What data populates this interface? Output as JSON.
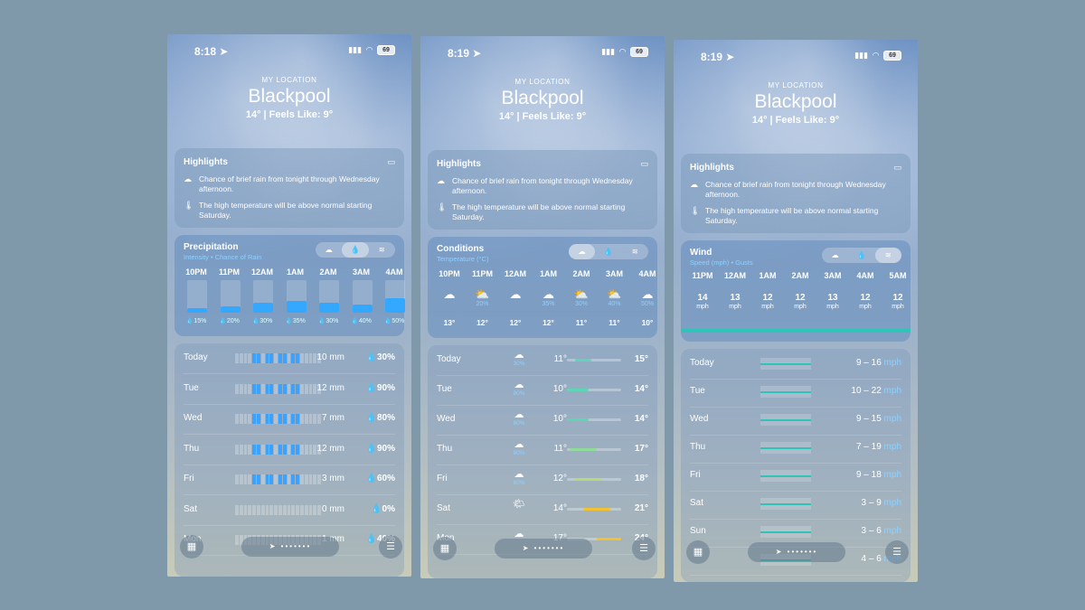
{
  "phones": [
    {
      "status": {
        "time": "8:18",
        "battery": "69"
      },
      "header": {
        "my_location": "MY LOCATION",
        "city": "Blackpool",
        "feels": "14°  |  Feels Like: 9°"
      },
      "highlights": {
        "title": "Highlights",
        "lines": [
          "Chance of brief rain from tonight through Wednesday afternoon.",
          "The high temperature will be above normal starting Saturday."
        ]
      },
      "module": {
        "title": "Precipitation",
        "subtitle": "Intensity • Chance of Rain",
        "hours": [
          {
            "label": "10PM",
            "chance": "15%",
            "level": 0.15
          },
          {
            "label": "11PM",
            "chance": "20%",
            "level": 0.2
          },
          {
            "label": "12AM",
            "chance": "30%",
            "level": 0.3
          },
          {
            "label": "1AM",
            "chance": "35%",
            "level": 0.35
          },
          {
            "label": "2AM",
            "chance": "30%",
            "level": 0.3
          },
          {
            "label": "3AM",
            "chance": "40%",
            "level": 0.25
          },
          {
            "label": "4AM",
            "chance": "50%",
            "level": 0.45
          }
        ]
      },
      "days": [
        {
          "name": "Today",
          "amount": "10 mm",
          "chance": "30%"
        },
        {
          "name": "Tue",
          "amount": "12 mm",
          "chance": "90%"
        },
        {
          "name": "Wed",
          "amount": "7 mm",
          "chance": "80%"
        },
        {
          "name": "Thu",
          "amount": "12 mm",
          "chance": "90%"
        },
        {
          "name": "Fri",
          "amount": "3 mm",
          "chance": "60%"
        },
        {
          "name": "Sat",
          "amount": "0 mm",
          "chance": "0%"
        },
        {
          "name": "Mon",
          "amount": "1 mm",
          "chance": "40%"
        }
      ]
    },
    {
      "status": {
        "time": "8:19",
        "battery": "69"
      },
      "header": {
        "my_location": "MY LOCATION",
        "city": "Blackpool",
        "feels": "14°  |  Feels Like: 9°"
      },
      "highlights": {
        "title": "Highlights",
        "lines": [
          "Chance of brief rain from tonight through Wednesday afternoon.",
          "The high temperature will be above normal starting Saturday."
        ]
      },
      "module": {
        "title": "Conditions",
        "subtitle": "Temperature (°C)",
        "hours": [
          {
            "label": "10PM",
            "chance": "",
            "temp": "13°"
          },
          {
            "label": "11PM",
            "chance": "20%",
            "temp": "12°"
          },
          {
            "label": "12AM",
            "chance": "",
            "temp": "12°"
          },
          {
            "label": "1AM",
            "chance": "35%",
            "temp": "12°"
          },
          {
            "label": "2AM",
            "chance": "30%",
            "temp": "11°"
          },
          {
            "label": "3AM",
            "chance": "40%",
            "temp": "11°"
          },
          {
            "label": "4AM",
            "chance": "50%",
            "temp": "10°"
          }
        ]
      },
      "days": [
        {
          "name": "Today",
          "chance": "30%",
          "lo": "11°",
          "hi": "15°"
        },
        {
          "name": "Tue",
          "chance": "90%",
          "lo": "10°",
          "hi": "14°"
        },
        {
          "name": "Wed",
          "chance": "80%",
          "lo": "10°",
          "hi": "14°"
        },
        {
          "name": "Thu",
          "chance": "90%",
          "lo": "11°",
          "hi": "17°"
        },
        {
          "name": "Fri",
          "chance": "60%",
          "lo": "12°",
          "hi": "18°"
        },
        {
          "name": "Sat",
          "chance": "",
          "lo": "14°",
          "hi": "21°"
        },
        {
          "name": "Mon",
          "chance": "",
          "lo": "17°",
          "hi": "24°"
        }
      ]
    },
    {
      "status": {
        "time": "8:19",
        "battery": "69"
      },
      "header": {
        "my_location": "MY LOCATION",
        "city": "Blackpool",
        "feels": "14°  |  Feels Like: 9°"
      },
      "highlights": {
        "title": "Highlights",
        "lines": [
          "Chance of brief rain from tonight through Wednesday afternoon.",
          "The high temperature will be above normal starting Saturday."
        ]
      },
      "module": {
        "title": "Wind",
        "subtitle": "Speed (mph) • Gusts",
        "hours": [
          {
            "label": "11PM",
            "speed": "14",
            "unit": "mph"
          },
          {
            "label": "12AM",
            "speed": "13",
            "unit": "mph"
          },
          {
            "label": "1AM",
            "speed": "12",
            "unit": "mph"
          },
          {
            "label": "2AM",
            "speed": "12",
            "unit": "mph"
          },
          {
            "label": "3AM",
            "speed": "13",
            "unit": "mph"
          },
          {
            "label": "4AM",
            "speed": "12",
            "unit": "mph"
          },
          {
            "label": "5AM",
            "speed": "12",
            "unit": "mph"
          }
        ]
      },
      "days": [
        {
          "name": "Today",
          "range": "9 – 16",
          "unit": "mph"
        },
        {
          "name": "Tue",
          "range": "10 – 22",
          "unit": "mph"
        },
        {
          "name": "Wed",
          "range": "9 – 15",
          "unit": "mph"
        },
        {
          "name": "Thu",
          "range": "7 – 19",
          "unit": "mph"
        },
        {
          "name": "Fri",
          "range": "9 – 18",
          "unit": "mph"
        },
        {
          "name": "Sat",
          "range": "3 – 9",
          "unit": "mph"
        },
        {
          "name": "Sun",
          "range": "3 – 6",
          "unit": "mph"
        },
        {
          "name": "",
          "range": "4 – 6",
          "unit": "mph"
        }
      ]
    }
  ],
  "icons": {
    "location": "location-arrow-icon",
    "map": "map-icon",
    "list": "list-icon",
    "cloud": "cloud-icon",
    "thermometer": "thermometer-icon",
    "drop": "raindrop-icon",
    "wind": "wind-icon",
    "cloud_sun": "cloud-sun-icon",
    "message": "message-icon"
  },
  "colors": {
    "rain": "#34a8ff",
    "wind": "#2fc4b8",
    "temp_cool": "#5dd6b5",
    "temp_warm": "#f2c230"
  }
}
